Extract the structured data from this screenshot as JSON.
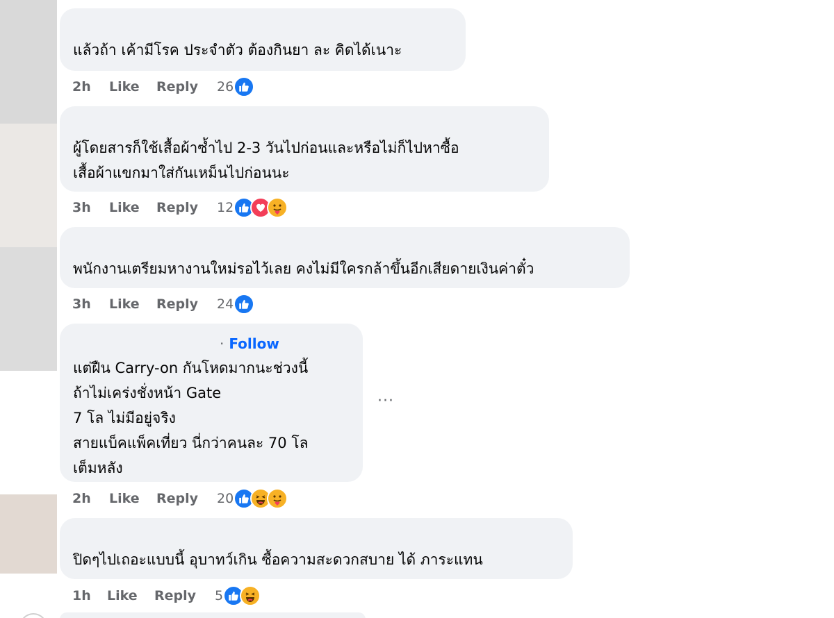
{
  "comments": [
    {
      "lines": [
        "แล้วถ้า เค้ามีโรค ประจำตัว ต้องกินยา ละ คิดได้เนาะ"
      ],
      "time": "2h",
      "like_label": "Like",
      "reply_label": "Reply",
      "reaction_count": "26",
      "reactions": [
        "like"
      ]
    },
    {
      "lines": [
        "ผู้โดยสารก็ใช้เสื้อผ้าซ้ำไป 2-3 วันไปก่อนและหรือไม่ก็ไปหาซื้อ",
        "เสื้อผ้าแขกมาใส่กันเหม็นไปก่อนนะ"
      ],
      "time": "3h",
      "like_label": "Like",
      "reply_label": "Reply",
      "reaction_count": "12",
      "reactions": [
        "like",
        "love",
        "care"
      ]
    },
    {
      "lines": [
        "พนักงานเตรียมหางานใหม่รอไว้เลย คงไม่มีใครกล้าขึ้นอีกเสียดายเงินค่าตั๋ว"
      ],
      "time": "3h",
      "like_label": "Like",
      "reply_label": "Reply",
      "reaction_count": "24",
      "reactions": [
        "like"
      ]
    },
    {
      "follow_label": "Follow",
      "follow_dot": "·",
      "lines": [
        "แต่ฝืน Carry-on กันโหดมากนะช่วงนี้",
        "ถ้าไม่เคร่งชั่งหน้า Gate",
        "7 โล ไม่มีอยู่จริง",
        "สายแบ็คแพ็คเที่ยว นี่กว่าคนละ 70 โล",
        "เต็มหลัง"
      ],
      "time": "2h",
      "like_label": "Like",
      "reply_label": "Reply",
      "reaction_count": "20",
      "reactions": [
        "like",
        "haha",
        "care"
      ],
      "more_label": "···"
    },
    {
      "lines": [
        "ปิดๆไปเถอะแบบนี้ อุบาทว์เกิน ซื้อความสะดวกสบาย ได้ ภาระแทน"
      ],
      "time": "1h",
      "like_label": "Like",
      "reply_label": "Reply",
      "reaction_count": "5",
      "reactions": [
        "like",
        "haha"
      ]
    }
  ],
  "colors": {
    "bubble": "#f0f2f5",
    "meta_text": "#65676b",
    "link": "#0866ff",
    "like": "#1877f2",
    "love": "#f33e58",
    "emoji": "#f7b125"
  },
  "icons": {
    "like": "thumbs-up-icon",
    "love": "heart-icon",
    "care": "care-emoji-icon",
    "haha": "haha-emoji-icon",
    "more": "more-options-icon"
  }
}
